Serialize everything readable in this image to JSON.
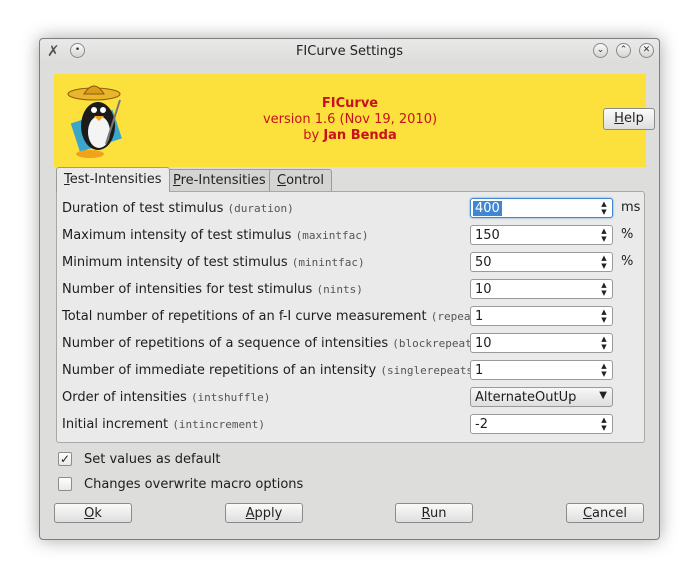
{
  "window": {
    "title": "FICurve Settings",
    "buttons": [
      "minimize",
      "maximize",
      "close"
    ]
  },
  "banner": {
    "name": "FICurve",
    "version_line": "version 1.6 (Nov 19, 2010)",
    "by": "by",
    "author": "Jan Benda",
    "help_label": "Help",
    "help_mnemonic": "H",
    "help_rest": "elp"
  },
  "tabs": [
    {
      "pre": "",
      "mn": "T",
      "rest": "est-Intensities",
      "active": true
    },
    {
      "pre": "",
      "mn": "P",
      "rest": "re-Intensities",
      "active": false
    },
    {
      "pre": "",
      "mn": "C",
      "rest": "ontrol",
      "active": false
    }
  ],
  "fields": [
    {
      "label": "Duration of test stimulus",
      "ident": "(duration)",
      "value": "400",
      "unit": "ms",
      "type": "spin",
      "focused": true
    },
    {
      "label": "Maximum intensity of test stimulus",
      "ident": "(maxintfac)",
      "value": "150",
      "unit": "%",
      "type": "spin"
    },
    {
      "label": "Minimum intensity of test stimulus",
      "ident": "(minintfac)",
      "value": "50",
      "unit": "%",
      "type": "spin"
    },
    {
      "label": "Number of intensities for test stimulus",
      "ident": "(nints)",
      "value": "10",
      "unit": "",
      "type": "spin"
    },
    {
      "label": "Total number of repetitions of an f-I curve measurement",
      "ident": "(repeats)",
      "value": "1",
      "unit": "",
      "type": "spin"
    },
    {
      "label": "Number of repetitions of a sequence of intensities",
      "ident": "(blockrepeats)",
      "value": "10",
      "unit": "",
      "type": "spin"
    },
    {
      "label": "Number of immediate repetitions of an intensity",
      "ident": "(singlerepeats)",
      "value": "1",
      "unit": "",
      "type": "spin"
    },
    {
      "label": "Order of intensities",
      "ident": "(intshuffle)",
      "value": "AlternateOutUp",
      "unit": "",
      "type": "combo"
    },
    {
      "label": "Initial increment",
      "ident": "(intincrement)",
      "value": "-2",
      "unit": "",
      "type": "spin"
    }
  ],
  "options": {
    "set_default": {
      "label": "Set values as default",
      "checked": true
    },
    "overwrite_macro": {
      "label": "Changes overwrite macro options",
      "checked": false
    }
  },
  "buttons": [
    {
      "mn": "O",
      "rest": "k"
    },
    {
      "mn": "A",
      "rest": "pply"
    },
    {
      "mn": "R",
      "rest": "un"
    },
    {
      "mn": "C",
      "rest": "ancel"
    }
  ],
  "colors": {
    "banner_bg": "#fce13c",
    "banner_text": "#c8101e",
    "selection": "#3f86d4"
  }
}
